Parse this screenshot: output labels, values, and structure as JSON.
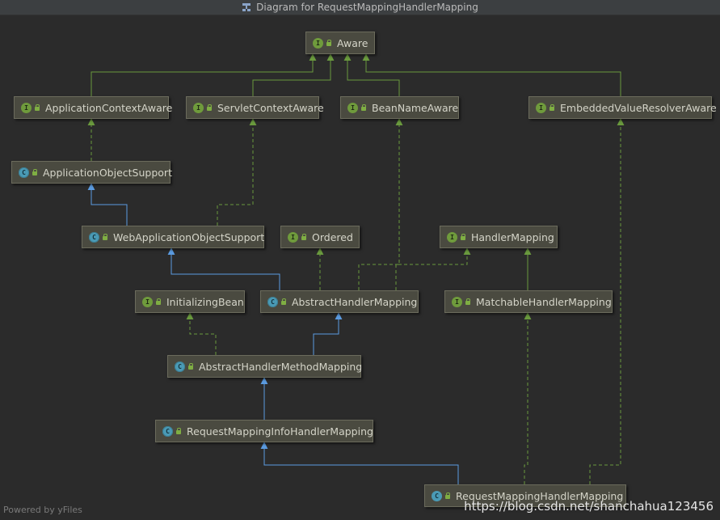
{
  "window": {
    "title": "Diagram for RequestMappingHandlerMapping"
  },
  "colors": {
    "background": "#2b2b2b",
    "implements_edge": "#6a9a3e",
    "extends_edge": "#5b9be0",
    "node_fill": "#4a4a40"
  },
  "nodes": [
    {
      "id": "aware",
      "label": "Aware",
      "kind": "interface",
      "kind_letter": "I"
    },
    {
      "id": "app-context-aware",
      "label": "ApplicationContextAware",
      "kind": "interface",
      "kind_letter": "I"
    },
    {
      "id": "servlet-context-aware",
      "label": "ServletContextAware",
      "kind": "interface",
      "kind_letter": "I"
    },
    {
      "id": "bean-name-aware",
      "label": "BeanNameAware",
      "kind": "interface",
      "kind_letter": "I"
    },
    {
      "id": "embedded-value-resolver-aware",
      "label": "EmbeddedValueResolverAware",
      "kind": "interface",
      "kind_letter": "I"
    },
    {
      "id": "app-object-support",
      "label": "ApplicationObjectSupport",
      "kind": "abstract",
      "kind_letter": "C"
    },
    {
      "id": "web-app-object-support",
      "label": "WebApplicationObjectSupport",
      "kind": "abstract",
      "kind_letter": "C"
    },
    {
      "id": "ordered",
      "label": "Ordered",
      "kind": "interface",
      "kind_letter": "I"
    },
    {
      "id": "handler-mapping",
      "label": "HandlerMapping",
      "kind": "interface",
      "kind_letter": "I"
    },
    {
      "id": "initializing-bean",
      "label": "InitializingBean",
      "kind": "interface",
      "kind_letter": "I"
    },
    {
      "id": "abstract-handler-mapping",
      "label": "AbstractHandlerMapping",
      "kind": "abstract",
      "kind_letter": "C"
    },
    {
      "id": "matchable-handler-mapping",
      "label": "MatchableHandlerMapping",
      "kind": "interface",
      "kind_letter": "I"
    },
    {
      "id": "abstract-handler-method-mapping",
      "label": "AbstractHandlerMethodMapping",
      "kind": "abstract",
      "kind_letter": "C"
    },
    {
      "id": "request-mapping-info-handler-mapping",
      "label": "RequestMappingInfoHandlerMapping",
      "kind": "abstract",
      "kind_letter": "C"
    },
    {
      "id": "request-mapping-handler-mapping",
      "label": "RequestMappingHandlerMapping",
      "kind": "class",
      "kind_letter": "C"
    }
  ],
  "edges": [
    {
      "from": "app-context-aware",
      "to": "aware",
      "type": "extends-interface"
    },
    {
      "from": "servlet-context-aware",
      "to": "aware",
      "type": "extends-interface"
    },
    {
      "from": "bean-name-aware",
      "to": "aware",
      "type": "extends-interface"
    },
    {
      "from": "embedded-value-resolver-aware",
      "to": "aware",
      "type": "extends-interface"
    },
    {
      "from": "app-object-support",
      "to": "app-context-aware",
      "type": "implements"
    },
    {
      "from": "web-app-object-support",
      "to": "app-object-support",
      "type": "extends"
    },
    {
      "from": "web-app-object-support",
      "to": "servlet-context-aware",
      "type": "implements"
    },
    {
      "from": "abstract-handler-mapping",
      "to": "web-app-object-support",
      "type": "extends"
    },
    {
      "from": "abstract-handler-mapping",
      "to": "ordered",
      "type": "implements"
    },
    {
      "from": "abstract-handler-mapping",
      "to": "bean-name-aware",
      "type": "implements"
    },
    {
      "from": "abstract-handler-mapping",
      "to": "handler-mapping",
      "type": "implements"
    },
    {
      "from": "matchable-handler-mapping",
      "to": "handler-mapping",
      "type": "extends-interface"
    },
    {
      "from": "abstract-handler-method-mapping",
      "to": "initializing-bean",
      "type": "implements"
    },
    {
      "from": "abstract-handler-method-mapping",
      "to": "abstract-handler-mapping",
      "type": "extends"
    },
    {
      "from": "request-mapping-info-handler-mapping",
      "to": "abstract-handler-method-mapping",
      "type": "extends"
    },
    {
      "from": "request-mapping-handler-mapping",
      "to": "request-mapping-info-handler-mapping",
      "type": "extends"
    },
    {
      "from": "request-mapping-handler-mapping",
      "to": "matchable-handler-mapping",
      "type": "implements"
    },
    {
      "from": "request-mapping-handler-mapping",
      "to": "embedded-value-resolver-aware",
      "type": "implements"
    }
  ],
  "footer": "Powered by yFiles",
  "watermark": "https://blog.csdn.net/shanchahua123456"
}
